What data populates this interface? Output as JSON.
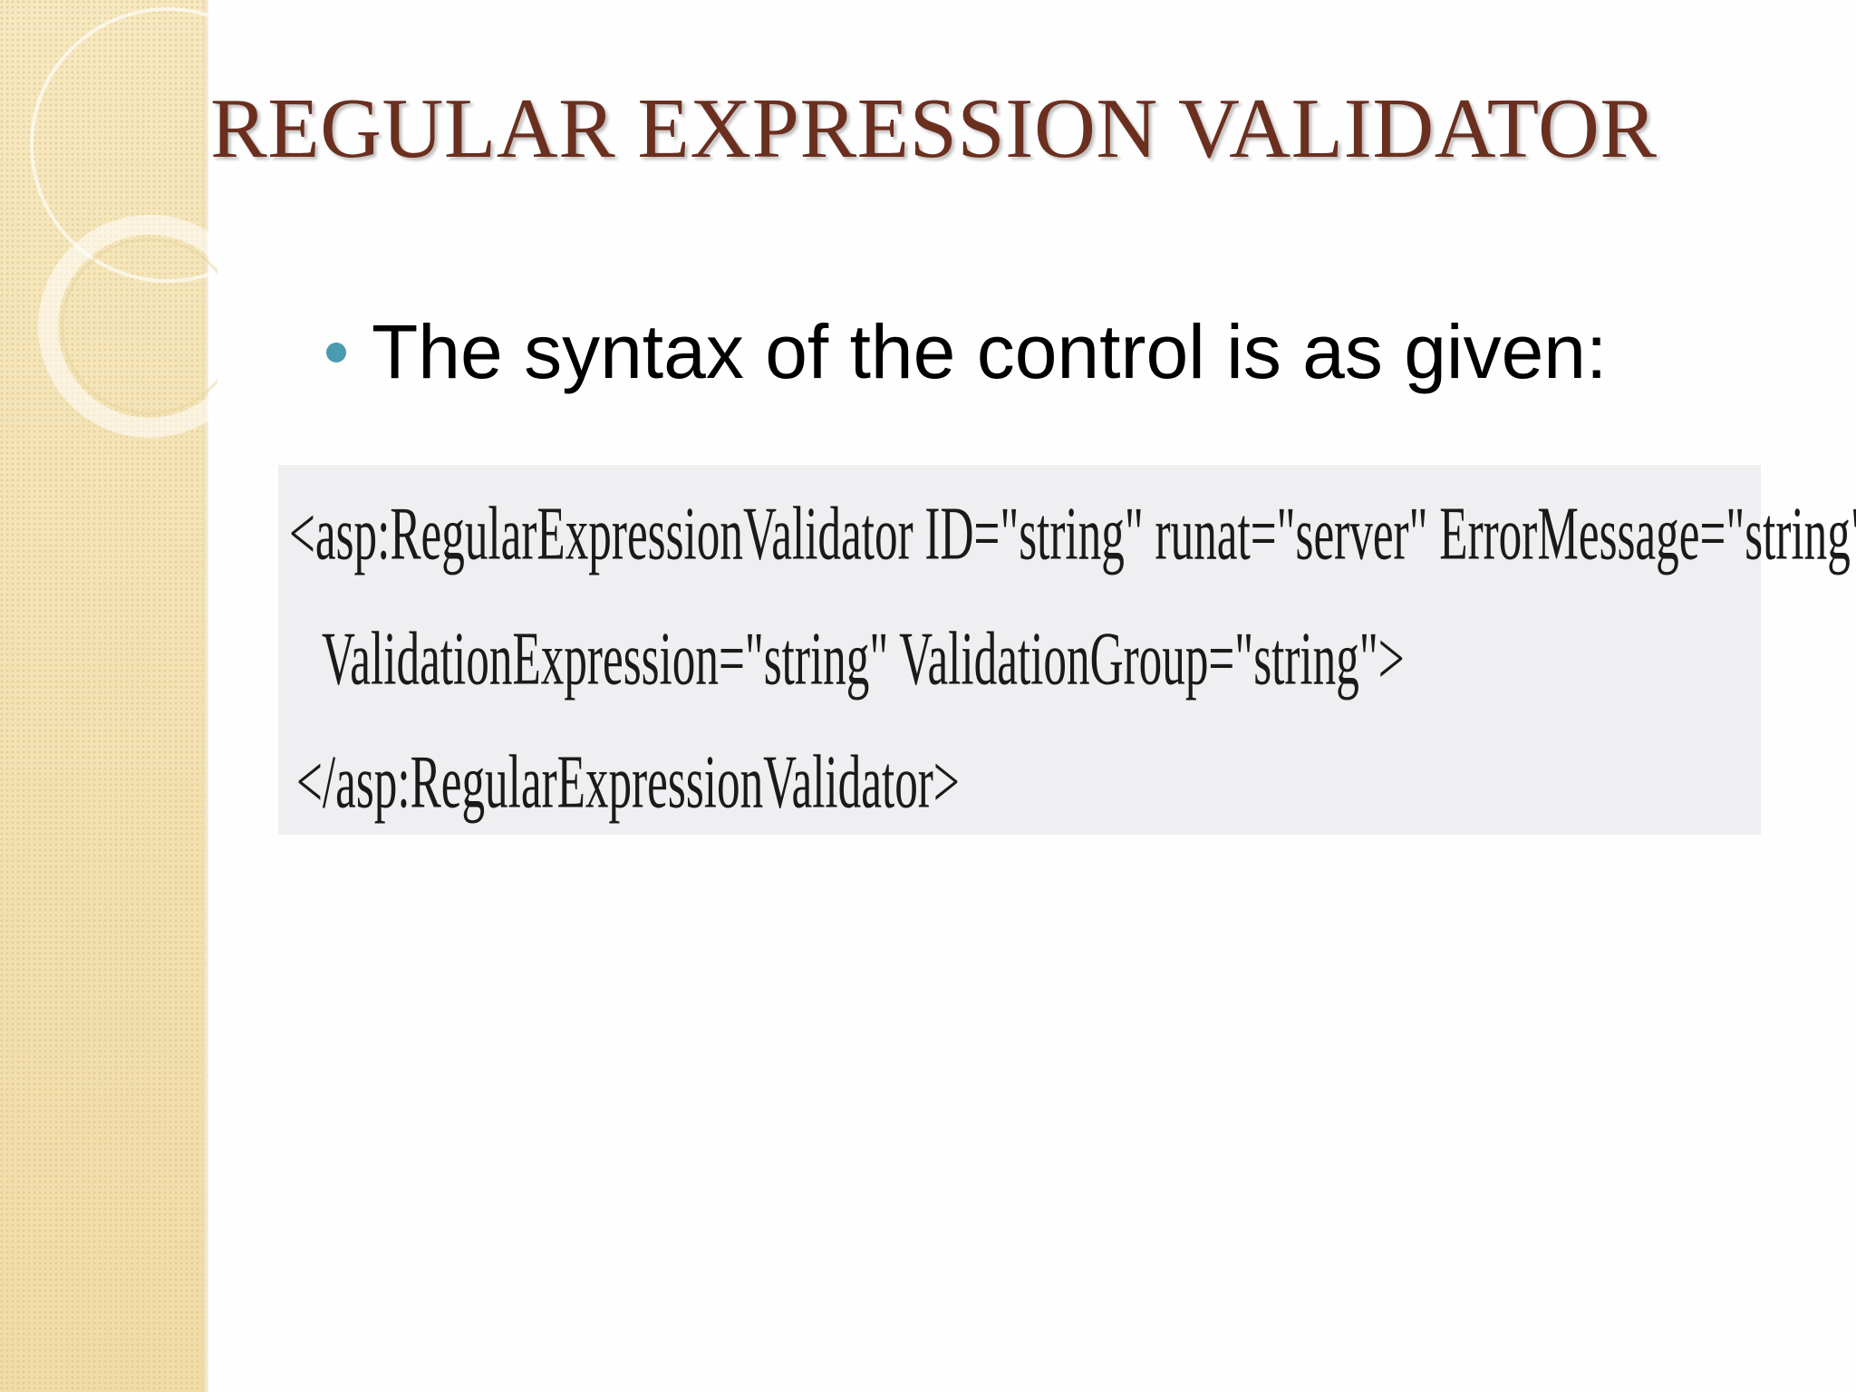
{
  "slide": {
    "title": "REGULAR EXPRESSION VALIDATOR",
    "bullet": "The syntax of the control is as given:",
    "code_lines": [
      "<asp:RegularExpressionValidator ID=\"string\" runat=\"server\" ErrorMessage=\"string\"",
      "ValidationExpression=\"string\" ValidationGroup=\"string\">",
      "</asp:RegularExpressionValidator>"
    ]
  },
  "colors": {
    "title": "#6b2f1f",
    "bullet_dot": "#4a9ab0",
    "side_panel": "#f4e3b6",
    "code_background": "#efeef0"
  }
}
